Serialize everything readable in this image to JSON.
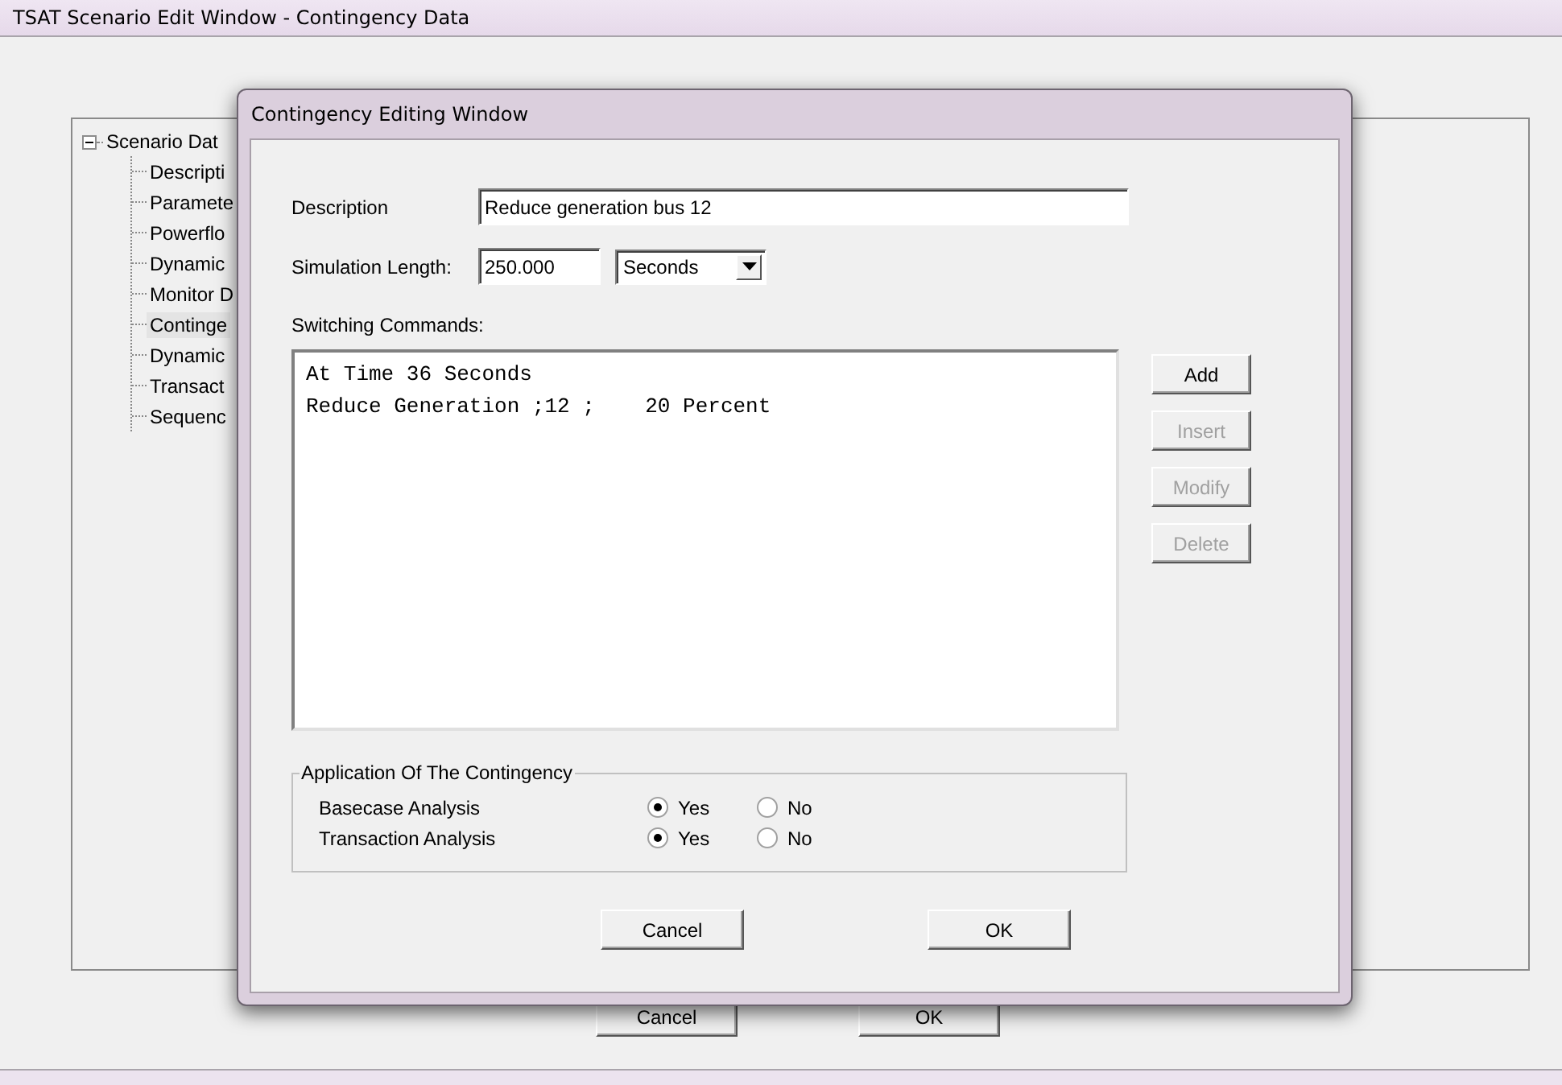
{
  "window": {
    "title": "TSAT Scenario Edit Window - Contingency Data"
  },
  "tree": {
    "label": "Scenario Dat",
    "expanded": true,
    "children": [
      {
        "label": "Descripti",
        "selected": false
      },
      {
        "label": "Paramete",
        "selected": false
      },
      {
        "label": "Powerflo",
        "selected": false
      },
      {
        "label": "Dynamic",
        "selected": false
      },
      {
        "label": "Monitor D",
        "selected": false
      },
      {
        "label": "Continge",
        "selected": true
      },
      {
        "label": "Dynamic",
        "selected": false
      },
      {
        "label": "Transact",
        "selected": false
      },
      {
        "label": "Sequenc",
        "selected": false
      }
    ]
  },
  "dialog": {
    "title": "Contingency Editing Window",
    "description": {
      "label": "Description",
      "value": "Reduce generation bus 12"
    },
    "simulation_length": {
      "label": "Simulation Length:",
      "value": "250.000",
      "unit": "Seconds"
    },
    "switching_commands": {
      "label": "Switching Commands:",
      "lines": [
        "At Time 36 Seconds",
        "Reduce Generation ;12 ;    20 Percent"
      ]
    },
    "side_buttons": [
      {
        "label": "Add",
        "disabled": false
      },
      {
        "label": "Insert",
        "disabled": true
      },
      {
        "label": "Modify",
        "disabled": true
      },
      {
        "label": "Delete",
        "disabled": true
      }
    ],
    "application": {
      "title": "Application Of The Contingency",
      "rows": [
        {
          "label": "Basecase Analysis",
          "options": [
            {
              "label": "Yes",
              "selected": true
            },
            {
              "label": "No",
              "selected": false
            }
          ]
        },
        {
          "label": "Transaction Analysis",
          "options": [
            {
              "label": "Yes",
              "selected": true
            },
            {
              "label": "No",
              "selected": false
            }
          ]
        }
      ]
    },
    "buttons": [
      "Cancel",
      "OK"
    ]
  },
  "buttons": [
    "Cancel",
    "OK"
  ]
}
